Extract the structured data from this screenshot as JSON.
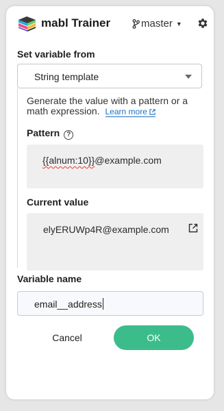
{
  "header": {
    "app_title": "mabl Trainer",
    "branch": "master"
  },
  "form": {
    "set_variable_label": "Set variable from",
    "source_select_value": "String template",
    "description": "Generate the value with a pattern or a math expression.",
    "learn_more": "Learn more",
    "pattern_label": "Pattern",
    "pattern_token": "{{alnum:10}}",
    "pattern_rest": "@example.com",
    "current_value_label": "Current value",
    "current_value": "elyERUWp4R@example.com",
    "variable_name_label": "Variable name",
    "variable_name_value": "email__address"
  },
  "actions": {
    "cancel_label": "Cancel",
    "ok_label": "OK"
  },
  "colors": {
    "accent_green": "#3cbc8b",
    "link_blue": "#1a6fc4",
    "background": "#e6e6e6"
  }
}
